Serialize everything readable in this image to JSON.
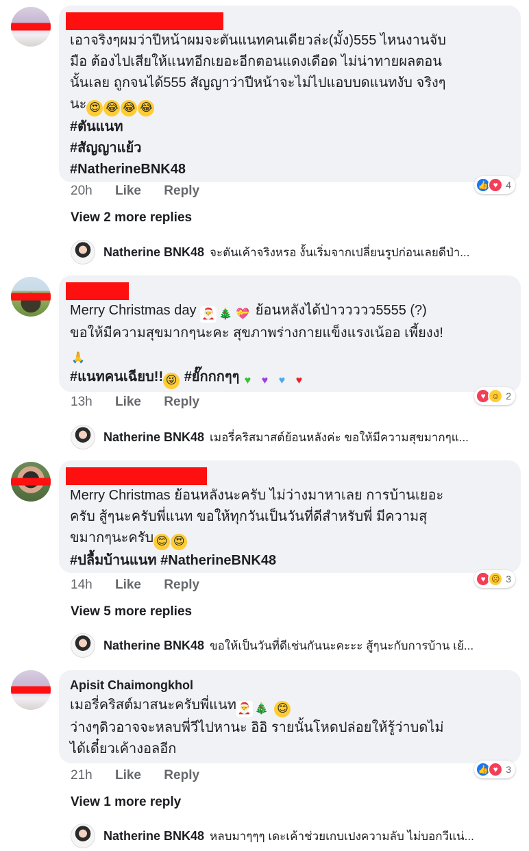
{
  "comments": [
    {
      "lines": [
        "เอาจริงๆผมว่าปีหน้าผมจะตันแนทคนเดียวล่ะ(มั้ง)555 ไหนงานจับ",
        "มือ ต้องไปเสียให้แนทอีกเยอะอีกตอนแดงเดือด ไม่น่าทายผลตอน",
        "นั้นเลย ถูกจนได้555 สัญญาว่าปีหน้าจะไม่ไปแอบบดแนทงับ จริงๆ",
        "นะ"
      ],
      "hashtags": [
        "#ตันแนท",
        "#สัญญาแย้ว",
        "#NatherineBNK48"
      ],
      "time": "20h",
      "like": "Like",
      "reply": "Reply",
      "reaction_count": "4",
      "more_replies": "View 2 more replies",
      "reply_name": "Natherine BNK48",
      "reply_text": "จะตันเค้าจริงหรอ งั้นเริ่มจากเปลี่ยนรูปก่อนเลยดีป่า..."
    },
    {
      "lines": [
        "Merry Christmas day",
        "ย้อนหลังได้ป่าววววว5555 (?)",
        "ขอให้มีความสุขมากๆนะคะ สุขภาพร่างกายแข็งแรงเน้ออ เพี้ยงง!"
      ],
      "hashtags": [
        "#แนทคนเฉียบ!!",
        "#ยั๊กกกๆๆ"
      ],
      "time": "13h",
      "like": "Like",
      "reply": "Reply",
      "reaction_count": "2",
      "reply_name": "Natherine BNK48",
      "reply_text": "เมอรี่คริสมาสต์ย้อนหลังค่ะ ขอให้มีความสุขมากๆแ..."
    },
    {
      "lines": [
        "Merry Christmas ย้อนหลังนะครับ ไม่ว่างมาหาเลย การบ้านเยอะ",
        "ครับ สู้ๆนะครับพี่แนท ขอให้ทุกวันเป็นวันที่ดีสำหรับพี่ มีความสุ",
        "ขมากๆนะครับ"
      ],
      "hashtags": [
        "#ปลื้มบ้านแนท #NatherineBNK48"
      ],
      "time": "14h",
      "like": "Like",
      "reply": "Reply",
      "reaction_count": "3",
      "more_replies": "View 5 more replies",
      "reply_name": "Natherine BNK48",
      "reply_text": "ขอให้เป็นวันที่ดีเช่นกันนะคะะะ สู้ๆนะกับการบ้าน เย้..."
    },
    {
      "name": "Apisit Chaimongkhol",
      "lines": [
        "เมอรี่คริสต์มาสนะครับพี่แนท",
        "ว่างๆดิวอาจจะหลบพี่วีไปหานะ อิอิ รายนั้นโหดปล่อยให้รู้ว่าบดไม่",
        "ได้เดี๋ยวเค้างอลอีก"
      ],
      "time": "21h",
      "like": "Like",
      "reply": "Reply",
      "reaction_count": "3",
      "more_replies": "View 1 more reply",
      "reply_name": "Natherine BNK48",
      "reply_text": "หลบมาๆๆๆ เดะเค้าช่วยเกบเปงความลับ ไม่บอกวีแน่..."
    }
  ],
  "icons": {
    "reactions_1": [
      "like-icon",
      "love-icon"
    ],
    "reactions_2": [
      "love-icon",
      "haha-icon"
    ],
    "reactions_3": [
      "love-icon",
      "sad-icon"
    ],
    "reactions_4": [
      "like-icon",
      "love-icon"
    ]
  },
  "colors": {
    "bubble": "#f0f2f5",
    "redaction": "#ff1010",
    "like": "#1877f2",
    "love": "#f33e58"
  }
}
